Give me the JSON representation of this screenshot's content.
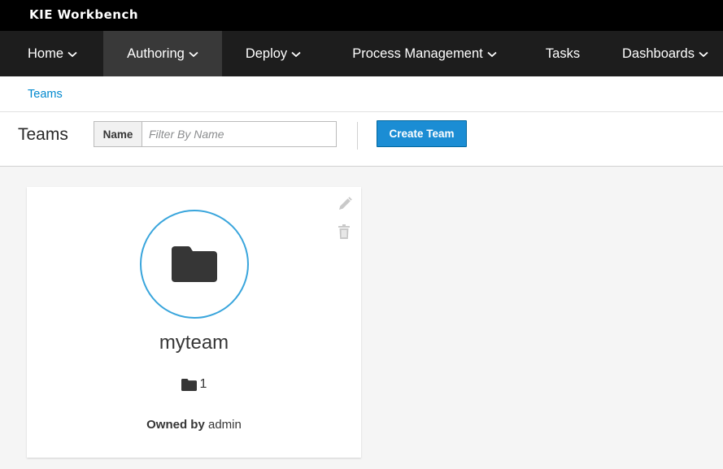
{
  "brand": "KIE Workbench",
  "nav": {
    "items": [
      {
        "label": "Home",
        "has_dropdown": true
      },
      {
        "label": "Authoring",
        "has_dropdown": true,
        "active": true
      },
      {
        "label": "Deploy",
        "has_dropdown": true
      },
      {
        "label": "Process Management",
        "has_dropdown": true
      },
      {
        "label": "Tasks",
        "has_dropdown": false
      },
      {
        "label": "Dashboards",
        "has_dropdown": true
      }
    ]
  },
  "breadcrumb": {
    "current": "Teams"
  },
  "toolbar": {
    "title": "Teams",
    "filter_label": "Name",
    "filter_placeholder": "Filter By Name",
    "filter_value": "",
    "create_label": "Create Team"
  },
  "teams": [
    {
      "name": "myteam",
      "icon": "folder-icon",
      "repo_count": "1",
      "owned_by_label": "Owned by",
      "owner": "admin"
    }
  ],
  "colors": {
    "accent": "#39a5dc",
    "primary_button": "#1b8dd4",
    "link": "#0088ce",
    "nav_bg": "#1d1d1d",
    "nav_active": "#393939"
  }
}
